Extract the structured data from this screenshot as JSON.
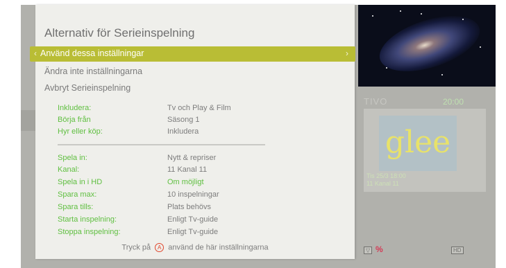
{
  "title": "Alternativ för Serieinspelning",
  "menu": {
    "selected": "Använd dessa inställningar",
    "items": [
      "Ändra inte inställningarna",
      "Avbryt Serieinspelning"
    ]
  },
  "group1": [
    {
      "label": "Inkludera:",
      "value": "Tv och Play & Film"
    },
    {
      "label": "Börja från",
      "value": "Säsong 1"
    },
    {
      "label": "Hyr eller köp:",
      "value": "Inkludera"
    }
  ],
  "group2": [
    {
      "label": "Spela in:",
      "value": "Nytt & repriser"
    },
    {
      "label": "Kanal:",
      "value": "11 Kanal 11"
    },
    {
      "label": "Spela in i HD",
      "value": "Om möjligt"
    },
    {
      "label": "Spara max:",
      "value": "10 inspelningar"
    },
    {
      "label": "Spara tills:",
      "value": "Plats behövs"
    },
    {
      "label": "Starta inspelning:",
      "value": "Enligt Tv-guide"
    },
    {
      "label": "Stoppa inspelning:",
      "value": "Enligt Tv-guide"
    }
  ],
  "footer": {
    "prefix": "Tryck på",
    "button": "A",
    "suffix": "använd de här inställningarna"
  },
  "background": {
    "brand": "TIVO",
    "time": "20:00",
    "program": {
      "thumbnail_text": "glee",
      "date": "Tis 25/3 18:00",
      "channel": "11 Kanal 11"
    },
    "badges": {
      "hd": "HD"
    }
  },
  "colors": {
    "highlight": "#b9bd35",
    "label_green": "#5fbf40",
    "footer_button": "#e0452c"
  }
}
